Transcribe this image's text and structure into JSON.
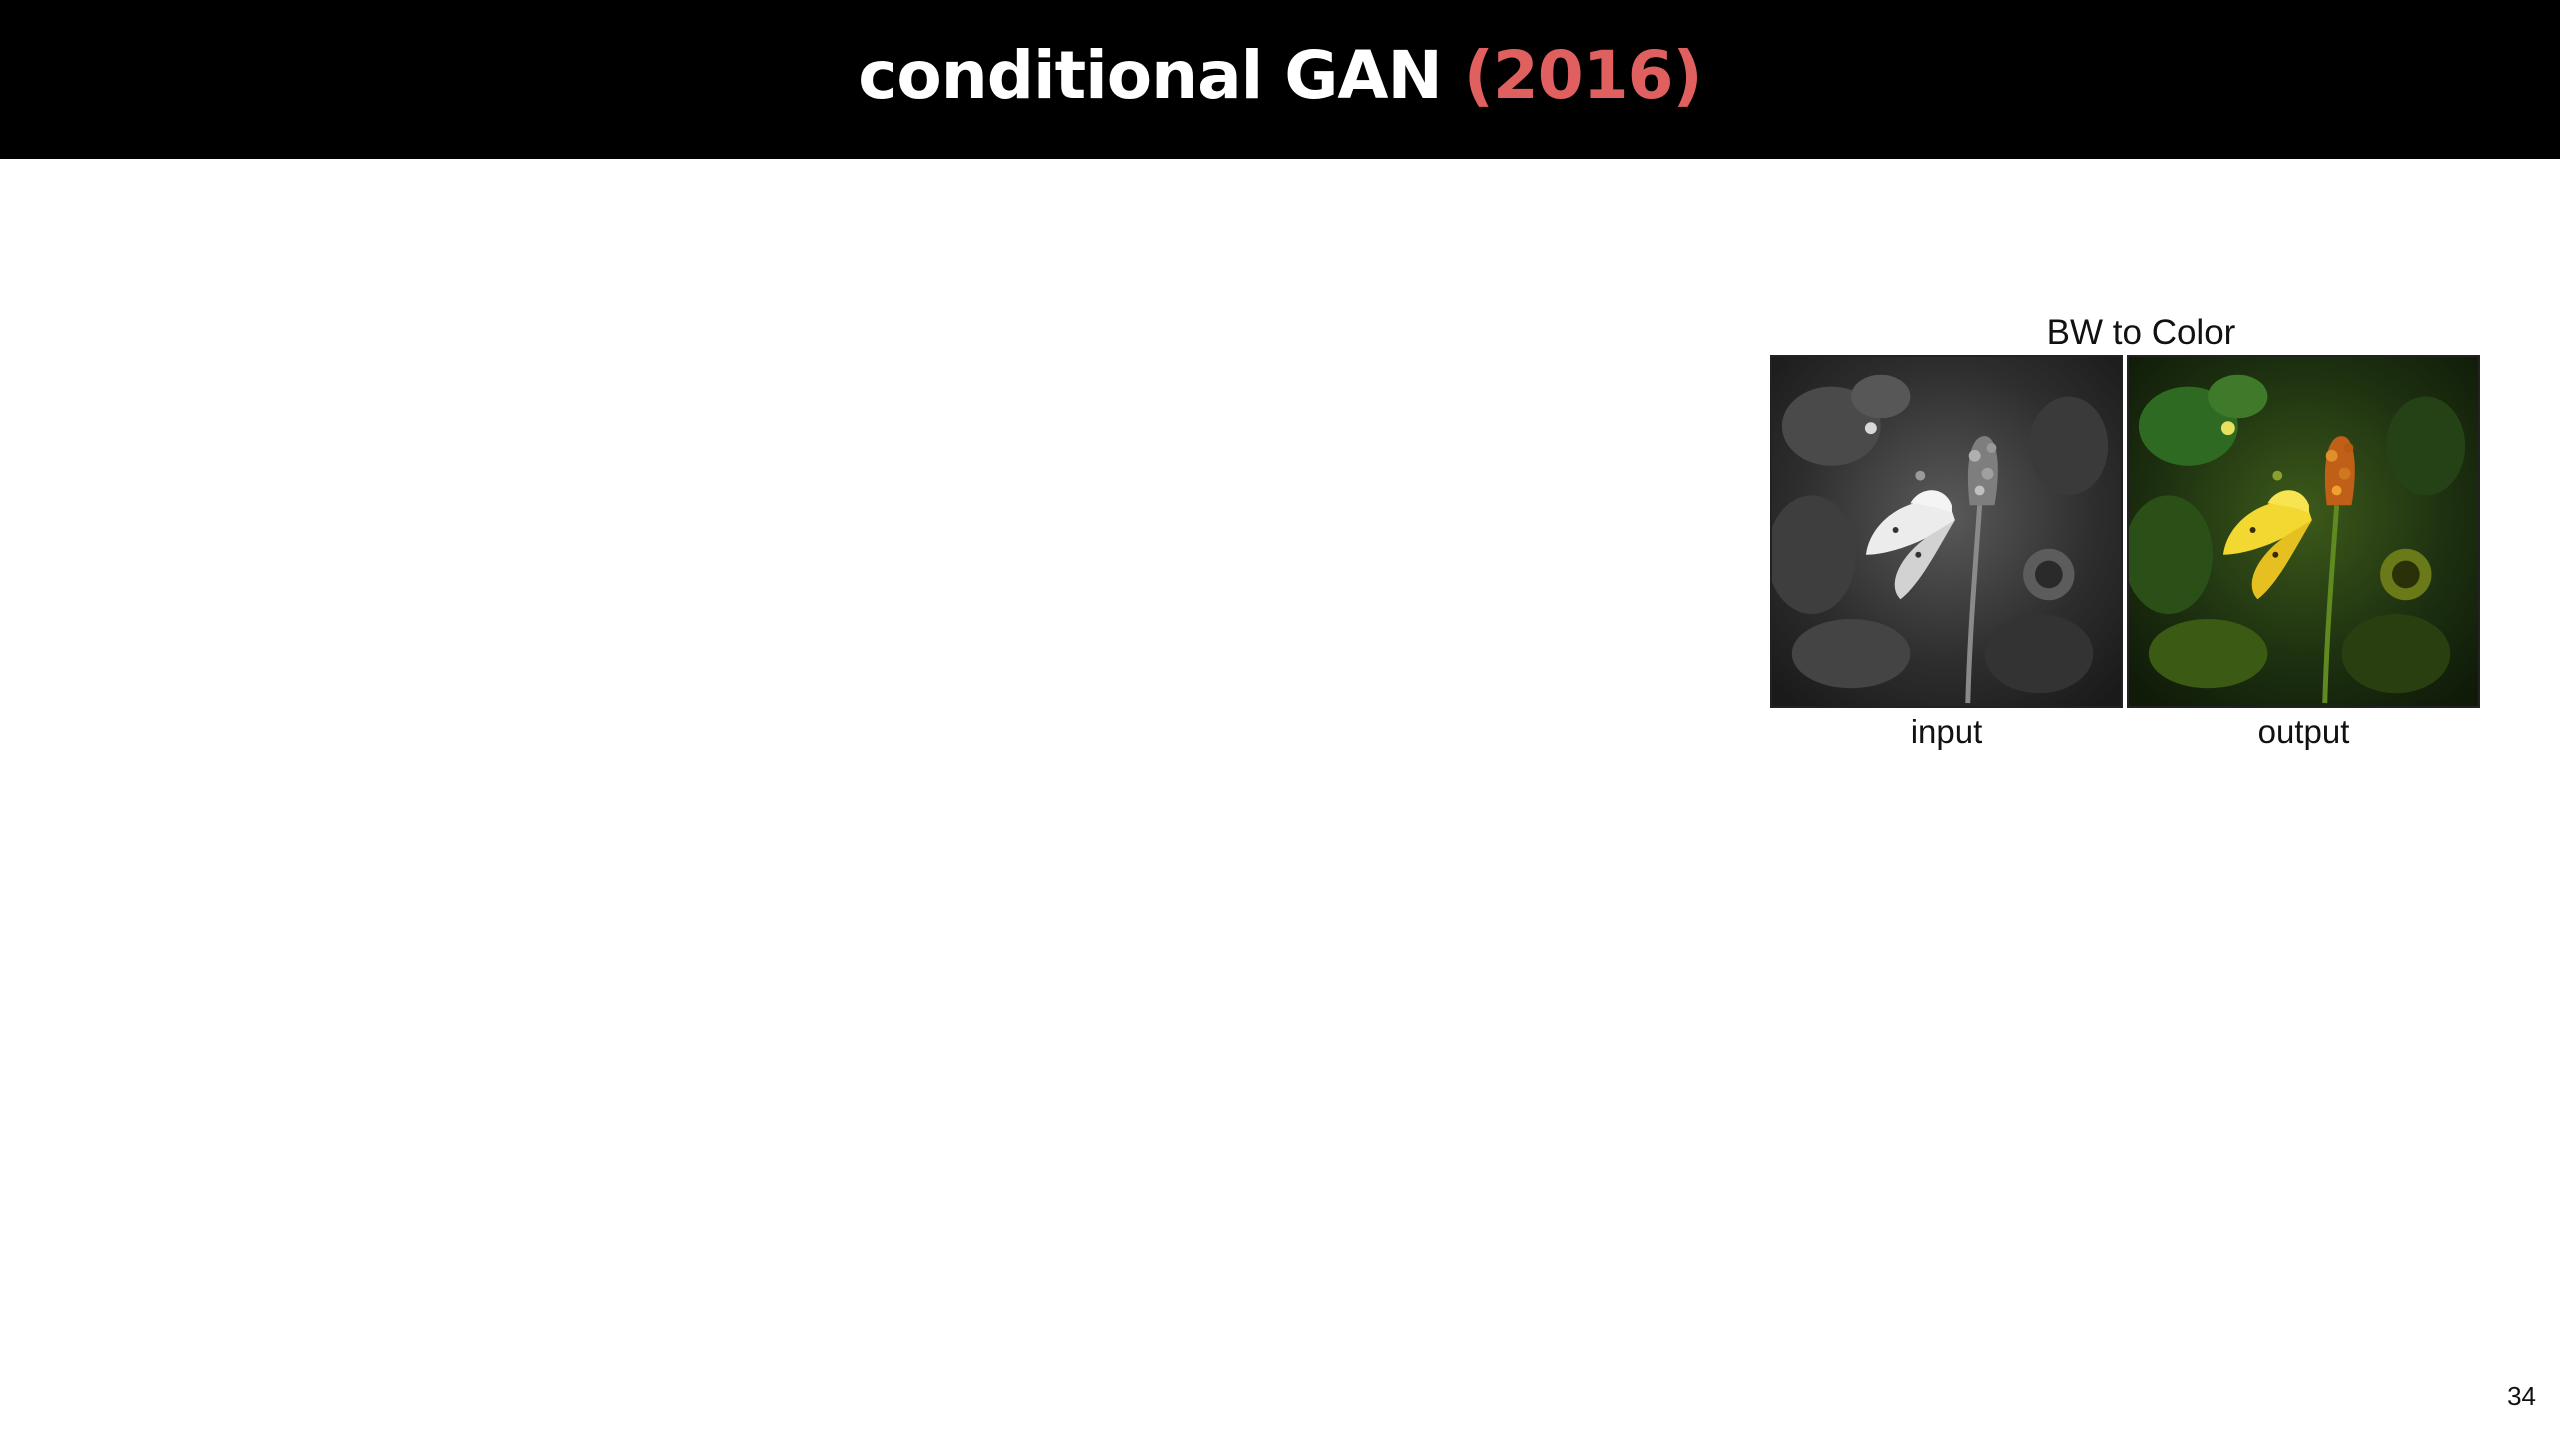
{
  "slide": {
    "title_main": "conditional GAN ",
    "title_year": "(2016)",
    "page_number": "34"
  },
  "figure": {
    "title": "BW to Color",
    "input_caption": "input",
    "output_caption": "output"
  },
  "colors": {
    "title_bar": "#000000",
    "title_text": "#ffffff",
    "year_accent": "#e06060"
  }
}
